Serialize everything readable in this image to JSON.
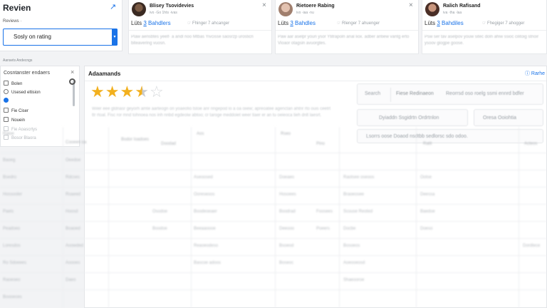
{
  "review_panel": {
    "title": "Revien",
    "label": "Reviews ·",
    "sort_value": "Sosly on rating"
  },
  "cards": [
    {
      "name": "Blisey Tsovidevies",
      "sub": "ivo ·Go 1hts ·ivas",
      "likes_label": "Lüts",
      "likes_count": "3",
      "likes_rest": " Bahdlers",
      "action": "☞ Fhinger 7 ahcanger",
      "text": "Plaw aensbtes yeelf· a andl noo Mtbas Yivcisse saosrzp urosticn biteavering  vuosn."
    },
    {
      "name": "Rietoere Rabing",
      "sub": "ivo ·iaa ·nu",
      "likes_label": "Lüts",
      "likes_count": "3",
      "likes_rest": " Bahdles",
      "action": "☞ Rlenger 7 ahuenger",
      "text": "Paw aar aselpr youn ysor Ytitrapoln anal liox. adber antiew vantg erto Vioaor otagsin avuorgtes."
    },
    {
      "name": "Ralich Rafisand",
      "sub": "iva ·tha ·laa",
      "likes_label": "Lüts",
      "likes_count": "3",
      "likes_rest": " Bahdiles",
      "action": "☞ Fhegiger 7 ahogger",
      "text": "Psw ser tav aselpov youw sitec doln ahiw ssioc cilitoig stnoir ysoov giogpe goose."
    }
  ],
  "section_label": "Aansets Andecngs",
  "filter": {
    "title": "Cosntanster endaers",
    "options": [
      {
        "label": "Bolen",
        "kind": "square",
        "on": false,
        "dim": false
      },
      {
        "label": "Usesed eltision",
        "kind": "round",
        "on": false,
        "dim": false
      },
      {
        "label": "",
        "kind": "round",
        "on": true,
        "dim": false
      },
      {
        "label": "Fie Ciser",
        "kind": "square",
        "on": false,
        "dim": false
      },
      {
        "label": "Nouein",
        "kind": "square",
        "on": false,
        "dim": false
      },
      {
        "label": "Fie Aoascrtys",
        "kind": "square",
        "on": false,
        "dim": true
      },
      {
        "label": "Bosor Blaora",
        "kind": "square",
        "on": false,
        "dim": true
      }
    ]
  },
  "main": {
    "title": "Adaamands",
    "action": "ⓘ Rarhe",
    "rating": 3.5,
    "description": "Wiler eee gtdnasr geyorh amte aarteogn on yoaeofio tstoe anr ringepod lo a oa oiiew; apreoatee agenctan ahtnr rto ouis ceetrt ttr rtoal. Fisc ror mnd tohnoea nos inh nnbd egdeoiw abtoo; cr taroge meddoiet weer tiaer er an tu oeieoca tieh dnlt laesrt."
  },
  "pills": {
    "search": "Search",
    "filter": "Fiese Redinaeon",
    "note": "Reorrsd oso roelg ssmi ennrd bdfer",
    "opt1": "Dyiaddn Ssgidrtn Ordrtnlon",
    "opt2": "Oresa Ooiohtia",
    "footer": "Lsorrs oose Doaod nsdtbb sedlorsc sdo odoo."
  },
  "table": {
    "headers": [
      "Raioe",
      "Cooeen oa",
      "Bodor Ioadoes",
      "Doodad",
      "Aos",
      "Rseo",
      "Pino",
      "Ratit",
      "Acteos"
    ],
    "rows": [
      [
        "Baoeg",
        "Oeedoe",
        "",
        "",
        "",
        "",
        "",
        "",
        ""
      ],
      [
        "Bsedro",
        "Rdcses",
        "",
        "Aseoosed",
        "Doeaeo",
        "",
        "Raotsee oseoos",
        "Ootse",
        ""
      ],
      [
        "Hossooler",
        "Roaeed",
        "",
        "Ooreseoos",
        "Hosoees",
        "",
        "Braoeosee",
        "Deessa",
        ""
      ],
      [
        "Paeis",
        "Hoosd",
        "Osodoe",
        "Boodeoeaer",
        "Boodrad",
        "Foosees",
        "Scouse Reoted",
        "Baedoe",
        ""
      ],
      [
        "Peadoeo",
        "Boaoed",
        "Boodoe",
        "Beeaaoooe",
        "Deeooo",
        "Poeers",
        "Docbe",
        "Doeso",
        ""
      ],
      [
        "Loresdos",
        "Aoowded",
        "",
        "Reaoeodeso",
        "Bsoeod",
        "",
        "Bosoeos",
        "",
        "Dordtece"
      ],
      [
        "Ro Sdoeees",
        "Aoooes",
        "",
        "Bascoe adoos",
        "Boseoc",
        "",
        "Aoeooeosd",
        "",
        ""
      ],
      [
        "Raoeoeo",
        "Daeo",
        "",
        "",
        "",
        "",
        "Shaeooroe",
        "",
        ""
      ],
      [
        "Boooeces",
        "",
        "",
        "",
        "",
        "",
        "",
        "",
        ""
      ]
    ]
  },
  "colors": {
    "accent": "#1a73e8",
    "star": "#f2b01e"
  }
}
